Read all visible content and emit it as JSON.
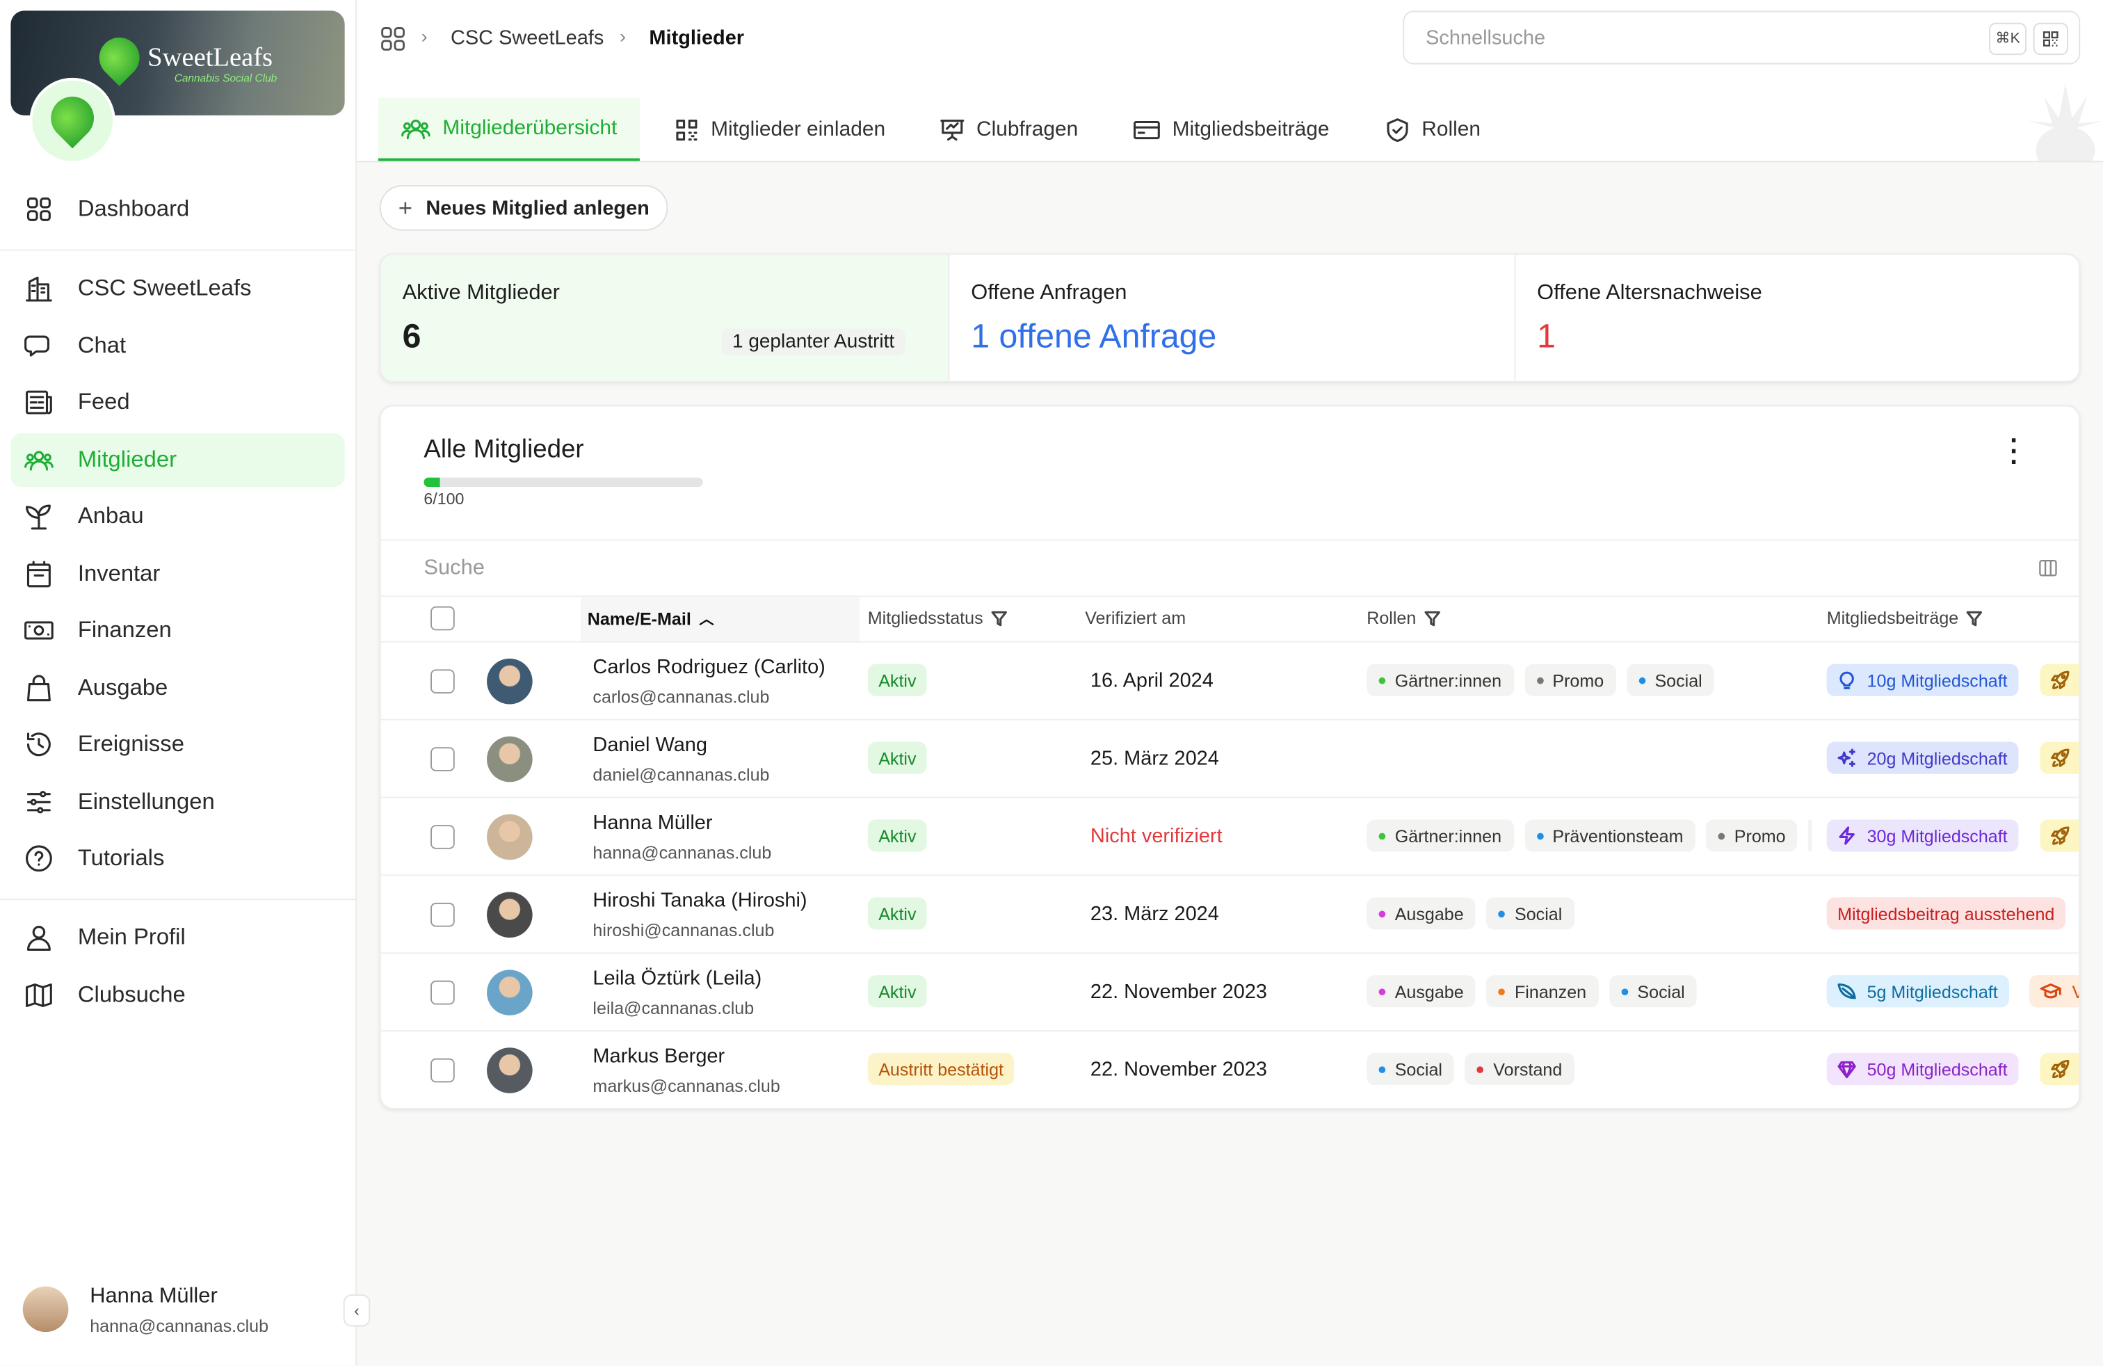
{
  "club": {
    "name": "SweetLeafs",
    "subtitle": "Cannabis Social Club"
  },
  "sidebar": {
    "items": [
      {
        "label": "Dashboard",
        "icon": "grid-icon"
      },
      {
        "label": "CSC SweetLeafs",
        "icon": "building-icon"
      },
      {
        "label": "Chat",
        "icon": "chat-icon"
      },
      {
        "label": "Feed",
        "icon": "newspaper-icon"
      },
      {
        "label": "Mitglieder",
        "icon": "users-icon",
        "active": true
      },
      {
        "label": "Anbau",
        "icon": "plant-icon"
      },
      {
        "label": "Inventar",
        "icon": "archive-icon"
      },
      {
        "label": "Finanzen",
        "icon": "cash-icon"
      },
      {
        "label": "Ausgabe",
        "icon": "shopping-bag-icon"
      },
      {
        "label": "Ereignisse",
        "icon": "history-icon"
      },
      {
        "label": "Einstellungen",
        "icon": "sliders-icon"
      },
      {
        "label": "Tutorials",
        "icon": "help-icon"
      },
      {
        "label": "Mein Profil",
        "icon": "user-icon"
      },
      {
        "label": "Clubsuche",
        "icon": "map-icon"
      }
    ],
    "user": {
      "name": "Hanna Müller",
      "email": "hanna@cannanas.club"
    }
  },
  "breadcrumb": {
    "items": [
      "CSC SweetLeafs",
      "Mitglieder"
    ]
  },
  "search": {
    "placeholder": "Schnellsuche",
    "shortcut": "⌘K"
  },
  "tabs": [
    {
      "label": "Mitgliederübersicht",
      "active": true
    },
    {
      "label": "Mitglieder einladen"
    },
    {
      "label": "Clubfragen"
    },
    {
      "label": "Mitgliedsbeiträge"
    },
    {
      "label": "Rollen"
    }
  ],
  "actions": {
    "new_member": "Neues Mitglied anlegen"
  },
  "stats": [
    {
      "label": "Aktive Mitglieder",
      "value": "6",
      "note": "1 geplanter Austritt"
    },
    {
      "label": "Offene Anfragen",
      "value": "1 offene Anfrage"
    },
    {
      "label": "Offene Altersnachweise",
      "value": "1"
    }
  ],
  "members": {
    "title": "Alle Mitglieder",
    "capacity": {
      "current": 6,
      "max": 100,
      "label": "6/100"
    },
    "search_placeholder": "Suche",
    "columns": [
      "Name/E-Mail",
      "Mitgliedsstatus",
      "Verifiziert am",
      "Rollen",
      "Mitgliedsbeiträge"
    ],
    "rows": [
      {
        "name": "Carlos Rodriguez (Carlito)",
        "email": "carlos@cannanas.club",
        "status": "Aktiv",
        "verified": "16. April 2024",
        "roles": [
          "Gärtner:innen",
          "Promo",
          "Social"
        ],
        "fee": "10g Mitgliedschaft",
        "fee_icon": "lightbulb-icon",
        "extra_icon": "rocket-icon",
        "extra": ""
      },
      {
        "name": "Daniel Wang",
        "email": "daniel@cannanas.club",
        "status": "Aktiv",
        "verified": "25. März 2024",
        "roles": [],
        "fee": "20g Mitgliedschaft",
        "fee_icon": "sparkles-icon",
        "extra_icon": "rocket-icon",
        "extra": ""
      },
      {
        "name": "Hanna Müller",
        "email": "hanna@cannanas.club",
        "status": "Aktiv",
        "verified": "Nicht verifiziert",
        "roles": [
          "Gärtner:innen",
          "Präventionsteam",
          "Promo"
        ],
        "fee": "30g Mitgliedschaft",
        "fee_icon": "bolt-icon",
        "extra_icon": "rocket-icon",
        "extra": ""
      },
      {
        "name": "Hiroshi Tanaka (Hiroshi)",
        "email": "hiroshi@cannanas.club",
        "status": "Aktiv",
        "verified": "23. März 2024",
        "roles": [
          "Ausgabe",
          "Social"
        ],
        "fee": "Mitgliedsbeitrag ausstehend",
        "fee_icon": "",
        "extra_icon": "",
        "extra": ""
      },
      {
        "name": "Leila Öztürk (Leila)",
        "email": "leila@cannanas.club",
        "status": "Aktiv",
        "verified": "22. November 2023",
        "roles": [
          "Ausgabe",
          "Finanzen",
          "Social"
        ],
        "fee": "5g Mitgliedschaft",
        "fee_icon": "leaf-icon",
        "extra_icon": "graduation-cap-icon",
        "extra": "V"
      },
      {
        "name": "Markus Berger",
        "email": "markus@cannanas.club",
        "status": "Austritt bestätigt",
        "verified": "22. November 2023",
        "roles": [
          "Social",
          "Vorstand"
        ],
        "fee": "50g Mitgliedschaft",
        "fee_icon": "gem-icon",
        "extra_icon": "rocket-icon",
        "extra": ""
      }
    ]
  },
  "colors": {
    "accent": "#22b33a",
    "link": "#2f6fe8",
    "danger": "#e5383b"
  }
}
